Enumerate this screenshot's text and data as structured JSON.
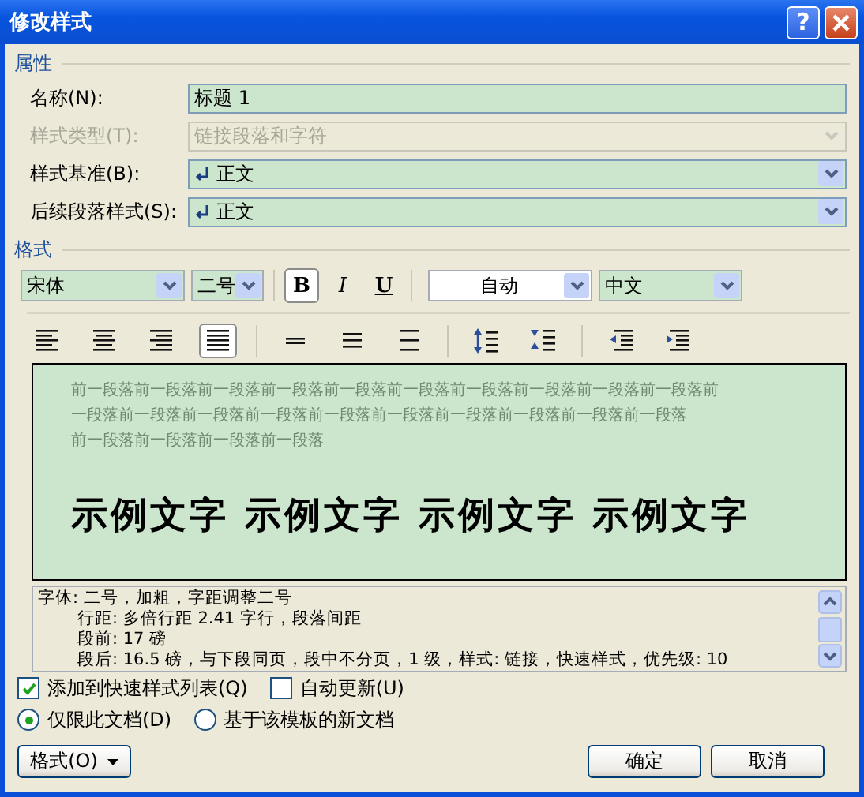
{
  "window": {
    "title": "修改样式",
    "help": "?"
  },
  "properties": {
    "heading": "属性",
    "fields": [
      {
        "label": "名称(N):",
        "kind": "text",
        "value": "标题 1",
        "disabled": false
      },
      {
        "label": "样式类型(T):",
        "kind": "select",
        "value": "链接段落和字符",
        "disabled": true
      },
      {
        "label": "样式基准(B):",
        "kind": "select",
        "value": "正文",
        "disabled": false
      },
      {
        "label": "后续段落样式(S):",
        "kind": "select",
        "value": "正文",
        "disabled": false
      }
    ]
  },
  "format": {
    "heading": "格式",
    "font": "宋体",
    "size": "二号",
    "styles": [
      {
        "label": "B",
        "kind": "bold",
        "pressed": true
      },
      {
        "label": "I",
        "kind": "italic",
        "pressed": false
      },
      {
        "label": "U",
        "kind": "underline",
        "pressed": false
      }
    ],
    "font_colour_setting": "自动",
    "language": "中文",
    "paragraph_buttons": [
      {
        "kind": "align-left",
        "pressed": false
      },
      {
        "kind": "align-center",
        "pressed": false
      },
      {
        "kind": "align-right",
        "pressed": false
      },
      {
        "kind": "justify",
        "pressed": true
      },
      {
        "kind": "single-spacing",
        "pressed": false
      },
      {
        "kind": "one-half-spacing",
        "pressed": false
      },
      {
        "kind": "double-spacing",
        "pressed": false
      },
      {
        "kind": "space-increase",
        "pressed": false
      },
      {
        "kind": "space-decrease",
        "pressed": false
      },
      {
        "kind": "indent-decrease",
        "pressed": false
      },
      {
        "kind": "indent-increase",
        "pressed": false
      }
    ]
  },
  "preview": {
    "previous_lines": [
      "前一段落前一段落前一段落前一段落前一段落前一段落前一段落前一段落前一段落前一段落前",
      "一段落前一段落前一段落前一段落前一段落前一段落前一段落前一段落前一段落前一段落",
      "前一段落前一段落前一段落前一段落"
    ],
    "sample": "示例文字 示例文字 示例文字 示例文字"
  },
  "description": {
    "lines": [
      "字体: 二号，加粗，字距调整二号",
      "行距: 多倍行距 2.41 字行，段落间距",
      "段前: 17 磅",
      "段后: 16.5 磅，与下段同页，段中不分页，1 级，样式: 链接，快速样式，优先级: 10"
    ]
  },
  "options": [
    {
      "kind": "checkbox",
      "label": "添加到快速样式列表(Q)",
      "checked": true
    },
    {
      "kind": "checkbox",
      "label": "自动更新(U)",
      "checked": false
    },
    {
      "kind": "radio",
      "label": "仅限此文档(D)",
      "selected": true
    },
    {
      "kind": "radio",
      "label": "基于该模板的新文档",
      "selected": false
    }
  ],
  "buttons": [
    {
      "kind": "menu",
      "label": "格式(O)"
    },
    {
      "kind": "plain",
      "label": "确定"
    },
    {
      "kind": "plain",
      "label": "取消"
    }
  ]
}
